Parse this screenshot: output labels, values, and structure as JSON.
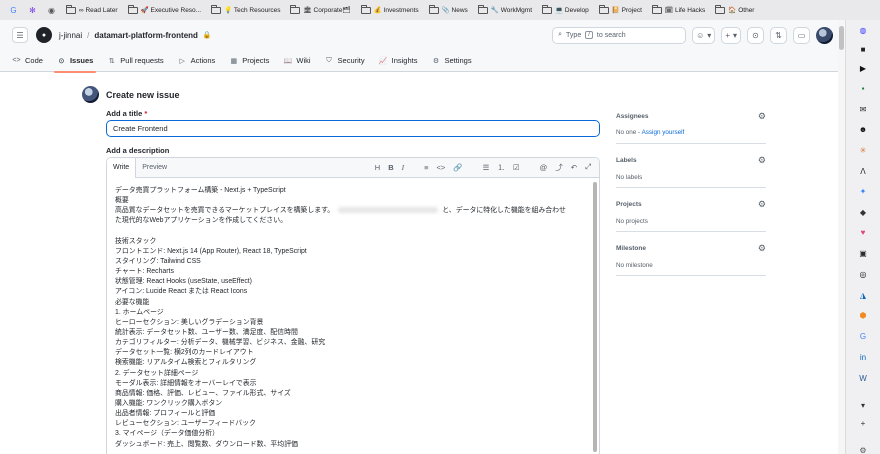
{
  "bookmarks": [
    {
      "label": "",
      "icon": "google-icon",
      "color": "#4285f4",
      "glyph": "G"
    },
    {
      "label": "",
      "icon": "app-icon",
      "color": "#7b3fe4",
      "glyph": "✻"
    },
    {
      "label": "",
      "icon": "profile-icon",
      "color": "#555555",
      "glyph": "◉"
    },
    {
      "label": "∞ Read Later",
      "icon": "folder-icon"
    },
    {
      "label": "🚀 Executive Reso...",
      "icon": "folder-icon"
    },
    {
      "label": "💡 Tech Resources",
      "icon": "folder-icon"
    },
    {
      "label": "🏛 Corporate🗂",
      "icon": "folder-icon"
    },
    {
      "label": "💰 Investments",
      "icon": "folder-icon"
    },
    {
      "label": "📎 News",
      "icon": "folder-icon"
    },
    {
      "label": "🔧 WorkMgmt",
      "icon": "folder-icon"
    },
    {
      "label": "💻 Develop",
      "icon": "folder-icon"
    },
    {
      "label": "📔 Project",
      "icon": "folder-icon"
    },
    {
      "label": "🗓 Life Hacks",
      "icon": "folder-icon"
    },
    {
      "label": "🏠 Other",
      "icon": "folder-icon"
    }
  ],
  "header": {
    "owner": "j-jinnai",
    "separator": "/",
    "repo": "datamart-platform-frontend",
    "search_prefix": "Type",
    "search_key": "/",
    "search_suffix": "to search",
    "plus_label": "+"
  },
  "tabs": [
    {
      "label": "Code",
      "icon": "code-icon",
      "glyph": "<>"
    },
    {
      "label": "Issues",
      "icon": "issue-icon",
      "glyph": "⊙",
      "active": true
    },
    {
      "label": "Pull requests",
      "icon": "pull-request-icon",
      "glyph": "⇅"
    },
    {
      "label": "Actions",
      "icon": "actions-icon",
      "glyph": "▷"
    },
    {
      "label": "Projects",
      "icon": "projects-icon",
      "glyph": "▦"
    },
    {
      "label": "Wiki",
      "icon": "wiki-icon",
      "glyph": "📖"
    },
    {
      "label": "Security",
      "icon": "shield-icon",
      "glyph": "⛉"
    },
    {
      "label": "Insights",
      "icon": "graph-icon",
      "glyph": "📈"
    },
    {
      "label": "Settings",
      "icon": "gear-icon",
      "glyph": "⚙"
    }
  ],
  "form": {
    "page_title": "Create new issue",
    "title_label": "Add a title",
    "required_mark": "*",
    "title_value": "Create Frontend",
    "description_label": "Add a description",
    "write_tab": "Write",
    "preview_tab": "Preview",
    "toolbar": {
      "heading": "H",
      "bold": "B",
      "italic": "I",
      "quote": "≡",
      "code": "<>",
      "link": "🔗",
      "bullet_list": "☰",
      "numbered_list": "⒈",
      "task_list": "☑",
      "mention": "@",
      "reference": "⤴",
      "undo": "↶",
      "fullscreen": "⤢"
    },
    "body_lines": [
      "データ売買プラットフォーム構築 - Next.js + TypeScript",
      "概要",
      "高品質なデータセットを売買できるマーケットプレイスを構築します。",
      "と、データに特化した機能を組み合わせ",
      "た現代的なWebアプリケーションを作成してください。",
      "",
      "技術スタック",
      "フロントエンド: Next.js 14 (App Router), React 18, TypeScript",
      "スタイリング: Tailwind CSS",
      "チャート: Recharts",
      "状態管理: React Hooks (useState, useEffect)",
      "アイコン: Lucide React または React Icons",
      "必要な機能",
      "1. ホームページ",
      "ヒーローセクション: 美しいグラデーション背景",
      "統計表示: データセット数、ユーザー数、満足度、配信時間",
      "カテゴリフィルター: 分析データ、機械学習、ビジネス、金融、研究",
      "データセット一覧: 横2列のカードレイアウト",
      "検索機能: リアルタイム検索とフィルタリング",
      "2. データセット詳細ページ",
      "モーダル表示: 詳細情報をオーバーレイで表示",
      "商品情報: 価格、評価、レビュー、ファイル形式、サイズ",
      "購入機能: ワンクリック購入ボタン",
      "出品者情報: プロフィールと評価",
      "レビューセクション: ユーザーフィードバック",
      "3. マイページ（データ価値分析）",
      "ダッシュボード: 売上、閲覧数、ダウンロード数、平均評価"
    ]
  },
  "sidebar": {
    "assignees_label": "Assignees",
    "assignees_value": "No one - ",
    "assign_yourself": "Assign yourself",
    "labels_label": "Labels",
    "labels_value": "No labels",
    "projects_label": "Projects",
    "projects_value": "No projects",
    "milestone_label": "Milestone",
    "milestone_value": "No milestone"
  },
  "dock": [
    {
      "icon": "copilot-icon",
      "glyph": "◍",
      "color": "#3b3bff"
    },
    {
      "icon": "app-square-icon",
      "glyph": "■",
      "color": "#222222"
    },
    {
      "icon": "play-icon",
      "glyph": "▶",
      "color": "#111111"
    },
    {
      "icon": "terminal-icon",
      "glyph": "▪",
      "color": "#1b7f3a"
    },
    {
      "icon": "chat-icon",
      "glyph": "✉",
      "color": "#222222"
    },
    {
      "icon": "face-icon",
      "glyph": "☻",
      "color": "#111111"
    },
    {
      "icon": "claude-icon",
      "glyph": "✳",
      "color": "#d9773b"
    },
    {
      "icon": "ai-icon",
      "glyph": "ᐱ",
      "color": "#222222"
    },
    {
      "icon": "sparkle-icon",
      "glyph": "✦",
      "color": "#3b82f6"
    },
    {
      "icon": "diamond-icon",
      "glyph": "◆",
      "color": "#333333"
    },
    {
      "icon": "heart-icon",
      "glyph": "♥",
      "color": "#e0457b"
    },
    {
      "icon": "image-icon",
      "glyph": "▣",
      "color": "#2b2b2b"
    },
    {
      "icon": "github-icon",
      "glyph": "◎",
      "color": "#111111"
    },
    {
      "icon": "azure-icon",
      "glyph": "◮",
      "color": "#0a66c2"
    },
    {
      "icon": "box-icon",
      "glyph": "⬢",
      "color": "#f08a24"
    },
    {
      "icon": "google-dock-icon",
      "glyph": "G",
      "color": "#4285f4"
    },
    {
      "icon": "linkedin-icon",
      "glyph": "in",
      "color": "#0a66c2"
    },
    {
      "icon": "word-icon",
      "glyph": "W",
      "color": "#2b579a"
    },
    {
      "icon": "chevron-down-icon",
      "glyph": "▾",
      "color": "#333333"
    },
    {
      "icon": "add-icon",
      "glyph": "+",
      "color": "#333333"
    },
    {
      "icon": "settings-icon",
      "glyph": "⚙",
      "color": "#555555"
    }
  ]
}
